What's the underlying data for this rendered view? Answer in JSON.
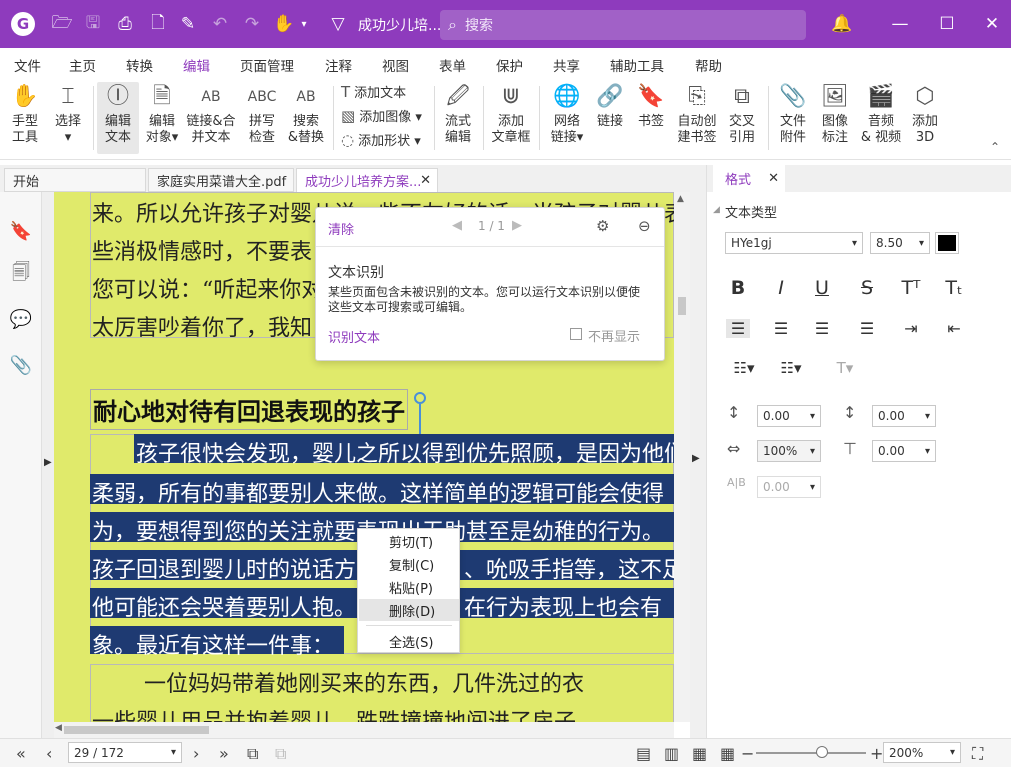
{
  "title_bar": {
    "logo": "G",
    "document_title": "成功少儿培...",
    "search_placeholder": "搜索",
    "icons": [
      "folder-open-icon",
      "save-icon",
      "print-icon",
      "new-file-icon",
      "undo-icon",
      "redo-icon",
      "hand-icon",
      "dropdown-icon",
      "bell-icon",
      "minimize-icon",
      "maximize-icon",
      "close-icon"
    ]
  },
  "menu": {
    "items": [
      "文件",
      "主页",
      "转换",
      "编辑",
      "页面管理",
      "注释",
      "视图",
      "表单",
      "保护",
      "共享",
      "辅助工具",
      "帮助"
    ],
    "active": "编辑"
  },
  "ribbon": {
    "hand": "手型\n工具",
    "select": "选择\n▾",
    "edit_text": "编辑\n文本",
    "edit_object": "编辑\n对象▾",
    "link_merge": "链接&合\n并文本",
    "spell": "拼写\n检查",
    "search_replace": "搜索\n&替换",
    "add_text": "添加文本",
    "add_image": "添加图像 ▾",
    "add_shape": "添加形状 ▾",
    "flow_edit": "流式\n编辑",
    "add_textbox": "添加\n文章框",
    "web_link": "网络\n链接▾",
    "link": "链接",
    "bookmark": "书签",
    "auto_bookmark": "自动创\n建书签",
    "cross_ref": "交叉\n引用",
    "file_attach": "文件\n附件",
    "image_annot": "图像\n标注",
    "audio_video": "音频\n& 视频",
    "add_3d": "添加\n3D"
  },
  "tabs": {
    "start": "开始",
    "tab2": "家庭实用菜谱大全.pdf",
    "tab3": "成功少儿培养方案..."
  },
  "page": {
    "lines_top": [
      "来。所以允许孩子对婴儿说一些不友好的话，当孩子对婴儿表",
      "些消极情感时，不要表",
      "您可以说：“听起来你对",
      "太厉害吵着你了，我知"
    ],
    "heading": "耐心地对待有回退表现的孩子",
    "selected_lines": [
      "孩子很快会发现，婴儿之所以得到优先照顾，是因为他们",
      "柔弱，所有的事都要别人来做。这样简单的逻辑可能会使得",
      "为，要想得到您的关注就要表现出无助甚至是幼稚的行为。",
      "孩子回退到婴儿时的说话方",
      "他可能还会哭着要别人抱。",
      "象。最近有这样一件事："
    ],
    "sel_fragment_4": "、吮吸手指等，这不足",
    "sel_fragment_5": "在行为表现上也会有",
    "lines_bottom": [
      "一位妈妈带着她刚买来的东西，几件洗过的衣",
      "一些婴儿用品并抱着婴儿，跌跌撞撞地闯进了房子"
    ]
  },
  "ocr_popup": {
    "clear": "清除",
    "page_indicator": "1 / 1",
    "title": "文本识别",
    "body": "某些页面包含未被识别的文本。您可以运行文本识别以便使这些文本可搜索或可编辑。",
    "action": "识别文本",
    "checkbox": "不再显示"
  },
  "context_menu": {
    "items": [
      "剪切(T)",
      "复制(C)",
      "粘贴(P)",
      "删除(D)",
      "全选(S)"
    ],
    "highlighted": "删除(D)"
  },
  "format_panel": {
    "tab": "格式",
    "section": "文本类型",
    "font": "HYe1gj",
    "size": "8.50",
    "color": "#000000",
    "spacing": [
      "0.00",
      "0.00",
      "100%",
      "0.00",
      "0.00"
    ]
  },
  "status_bar": {
    "page": "29 / 172",
    "zoom": "200%",
    "zoom_fraction": 0.6
  }
}
